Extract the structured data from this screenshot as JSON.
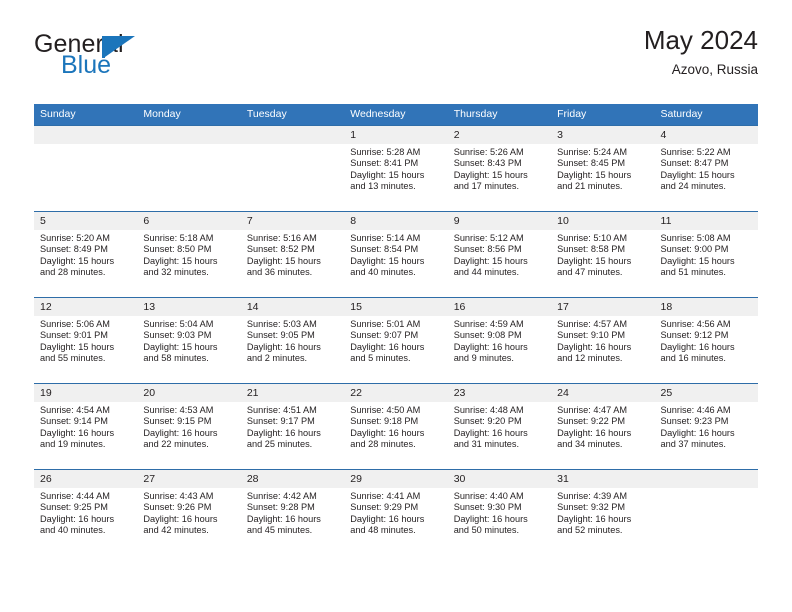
{
  "brand": {
    "name_top": "General",
    "name_bottom": "Blue",
    "flag_icon": "triangle-flag-icon",
    "accent_color": "#1b75bb"
  },
  "header": {
    "title": "May 2024",
    "location": "Azovo, Russia"
  },
  "theme": {
    "header_blue": "#3174b8",
    "separator_blue": "#2e6da8",
    "daynum_band_gray": "#f0f0f0",
    "text": "#231f20"
  },
  "calendar": {
    "weekday_headers": [
      "Sunday",
      "Monday",
      "Tuesday",
      "Wednesday",
      "Thursday",
      "Friday",
      "Saturday"
    ],
    "weeks": [
      [
        {
          "day": "",
          "lines": []
        },
        {
          "day": "",
          "lines": []
        },
        {
          "day": "",
          "lines": []
        },
        {
          "day": "1",
          "lines": [
            "Sunrise: 5:28 AM",
            "Sunset: 8:41 PM",
            "Daylight: 15 hours",
            "and 13 minutes."
          ]
        },
        {
          "day": "2",
          "lines": [
            "Sunrise: 5:26 AM",
            "Sunset: 8:43 PM",
            "Daylight: 15 hours",
            "and 17 minutes."
          ]
        },
        {
          "day": "3",
          "lines": [
            "Sunrise: 5:24 AM",
            "Sunset: 8:45 PM",
            "Daylight: 15 hours",
            "and 21 minutes."
          ]
        },
        {
          "day": "4",
          "lines": [
            "Sunrise: 5:22 AM",
            "Sunset: 8:47 PM",
            "Daylight: 15 hours",
            "and 24 minutes."
          ]
        }
      ],
      [
        {
          "day": "5",
          "lines": [
            "Sunrise: 5:20 AM",
            "Sunset: 8:49 PM",
            "Daylight: 15 hours",
            "and 28 minutes."
          ]
        },
        {
          "day": "6",
          "lines": [
            "Sunrise: 5:18 AM",
            "Sunset: 8:50 PM",
            "Daylight: 15 hours",
            "and 32 minutes."
          ]
        },
        {
          "day": "7",
          "lines": [
            "Sunrise: 5:16 AM",
            "Sunset: 8:52 PM",
            "Daylight: 15 hours",
            "and 36 minutes."
          ]
        },
        {
          "day": "8",
          "lines": [
            "Sunrise: 5:14 AM",
            "Sunset: 8:54 PM",
            "Daylight: 15 hours",
            "and 40 minutes."
          ]
        },
        {
          "day": "9",
          "lines": [
            "Sunrise: 5:12 AM",
            "Sunset: 8:56 PM",
            "Daylight: 15 hours",
            "and 44 minutes."
          ]
        },
        {
          "day": "10",
          "lines": [
            "Sunrise: 5:10 AM",
            "Sunset: 8:58 PM",
            "Daylight: 15 hours",
            "and 47 minutes."
          ]
        },
        {
          "day": "11",
          "lines": [
            "Sunrise: 5:08 AM",
            "Sunset: 9:00 PM",
            "Daylight: 15 hours",
            "and 51 minutes."
          ]
        }
      ],
      [
        {
          "day": "12",
          "lines": [
            "Sunrise: 5:06 AM",
            "Sunset: 9:01 PM",
            "Daylight: 15 hours",
            "and 55 minutes."
          ]
        },
        {
          "day": "13",
          "lines": [
            "Sunrise: 5:04 AM",
            "Sunset: 9:03 PM",
            "Daylight: 15 hours",
            "and 58 minutes."
          ]
        },
        {
          "day": "14",
          "lines": [
            "Sunrise: 5:03 AM",
            "Sunset: 9:05 PM",
            "Daylight: 16 hours",
            "and 2 minutes."
          ]
        },
        {
          "day": "15",
          "lines": [
            "Sunrise: 5:01 AM",
            "Sunset: 9:07 PM",
            "Daylight: 16 hours",
            "and 5 minutes."
          ]
        },
        {
          "day": "16",
          "lines": [
            "Sunrise: 4:59 AM",
            "Sunset: 9:08 PM",
            "Daylight: 16 hours",
            "and 9 minutes."
          ]
        },
        {
          "day": "17",
          "lines": [
            "Sunrise: 4:57 AM",
            "Sunset: 9:10 PM",
            "Daylight: 16 hours",
            "and 12 minutes."
          ]
        },
        {
          "day": "18",
          "lines": [
            "Sunrise: 4:56 AM",
            "Sunset: 9:12 PM",
            "Daylight: 16 hours",
            "and 16 minutes."
          ]
        }
      ],
      [
        {
          "day": "19",
          "lines": [
            "Sunrise: 4:54 AM",
            "Sunset: 9:14 PM",
            "Daylight: 16 hours",
            "and 19 minutes."
          ]
        },
        {
          "day": "20",
          "lines": [
            "Sunrise: 4:53 AM",
            "Sunset: 9:15 PM",
            "Daylight: 16 hours",
            "and 22 minutes."
          ]
        },
        {
          "day": "21",
          "lines": [
            "Sunrise: 4:51 AM",
            "Sunset: 9:17 PM",
            "Daylight: 16 hours",
            "and 25 minutes."
          ]
        },
        {
          "day": "22",
          "lines": [
            "Sunrise: 4:50 AM",
            "Sunset: 9:18 PM",
            "Daylight: 16 hours",
            "and 28 minutes."
          ]
        },
        {
          "day": "23",
          "lines": [
            "Sunrise: 4:48 AM",
            "Sunset: 9:20 PM",
            "Daylight: 16 hours",
            "and 31 minutes."
          ]
        },
        {
          "day": "24",
          "lines": [
            "Sunrise: 4:47 AM",
            "Sunset: 9:22 PM",
            "Daylight: 16 hours",
            "and 34 minutes."
          ]
        },
        {
          "day": "25",
          "lines": [
            "Sunrise: 4:46 AM",
            "Sunset: 9:23 PM",
            "Daylight: 16 hours",
            "and 37 minutes."
          ]
        }
      ],
      [
        {
          "day": "26",
          "lines": [
            "Sunrise: 4:44 AM",
            "Sunset: 9:25 PM",
            "Daylight: 16 hours",
            "and 40 minutes."
          ]
        },
        {
          "day": "27",
          "lines": [
            "Sunrise: 4:43 AM",
            "Sunset: 9:26 PM",
            "Daylight: 16 hours",
            "and 42 minutes."
          ]
        },
        {
          "day": "28",
          "lines": [
            "Sunrise: 4:42 AM",
            "Sunset: 9:28 PM",
            "Daylight: 16 hours",
            "and 45 minutes."
          ]
        },
        {
          "day": "29",
          "lines": [
            "Sunrise: 4:41 AM",
            "Sunset: 9:29 PM",
            "Daylight: 16 hours",
            "and 48 minutes."
          ]
        },
        {
          "day": "30",
          "lines": [
            "Sunrise: 4:40 AM",
            "Sunset: 9:30 PM",
            "Daylight: 16 hours",
            "and 50 minutes."
          ]
        },
        {
          "day": "31",
          "lines": [
            "Sunrise: 4:39 AM",
            "Sunset: 9:32 PM",
            "Daylight: 16 hours",
            "and 52 minutes."
          ]
        },
        {
          "day": "",
          "lines": []
        }
      ]
    ]
  }
}
